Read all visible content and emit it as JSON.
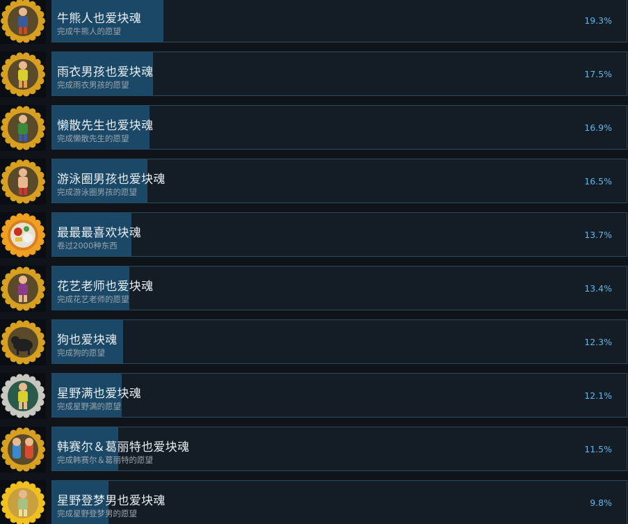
{
  "achievements": [
    {
      "title": "牛熊人也爱块魂",
      "description": "完成牛熊人的愿望",
      "percent_label": "19.3%",
      "percent": 19.3,
      "icon": "character-medallion-icon",
      "palette": [
        "#5a4a2a",
        "#d8a020",
        "#3a5a9a",
        "#c84a20"
      ]
    },
    {
      "title": "雨衣男孩也爱块魂",
      "description": "完成雨衣男孩的愿望",
      "percent_label": "17.5%",
      "percent": 17.5,
      "icon": "character-medallion-icon",
      "palette": [
        "#5a4a2a",
        "#d8a020",
        "#d8d030",
        "#e8a050"
      ]
    },
    {
      "title": "懒散先生也爱块魂",
      "description": "完成懒散先生的愿望",
      "percent_label": "16.9%",
      "percent": 16.9,
      "icon": "character-medallion-icon",
      "palette": [
        "#5a4a2a",
        "#d8a020",
        "#3a8a3a",
        "#3a5ab0"
      ]
    },
    {
      "title": "游泳圈男孩也爱块魂",
      "description": "完成游泳圈男孩的愿望",
      "percent_label": "16.5%",
      "percent": 16.5,
      "icon": "character-medallion-icon",
      "palette": [
        "#5a4a2a",
        "#d8a020",
        "#e8b890",
        "#d83030"
      ]
    },
    {
      "title": "最最最喜欢块魂",
      "description": "卷过2000种东西",
      "percent_label": "13.7%",
      "percent": 13.7,
      "icon": "katamari-ball-medallion-icon",
      "palette": [
        "#d88020",
        "#f0a020",
        "#e8e0d0",
        "#c83020"
      ]
    },
    {
      "title": "花艺老师也爱块魂",
      "description": "完成花艺老师的愿望",
      "percent_label": "13.4%",
      "percent": 13.4,
      "icon": "character-medallion-icon",
      "palette": [
        "#5a4a2a",
        "#d8a020",
        "#8a3a8a",
        "#e8b890"
      ]
    },
    {
      "title": "狗也爱块魂",
      "description": "完成狗的愿望",
      "percent_label": "12.3%",
      "percent": 12.3,
      "icon": "dog-medallion-icon",
      "palette": [
        "#5a4a2a",
        "#d8a020",
        "#202020",
        "#606060"
      ]
    },
    {
      "title": "星野满也爱块魂",
      "description": "完成星野满的愿望",
      "percent_label": "12.1%",
      "percent": 12.1,
      "icon": "character-medallion-icon",
      "palette": [
        "#2a5a4a",
        "#c8c8c0",
        "#d8d030",
        "#e8b890"
      ]
    },
    {
      "title": "韩赛尔＆葛丽特也爱块魂",
      "description": "完成韩赛尔＆葛丽特的愿望",
      "percent_label": "11.5%",
      "percent": 11.5,
      "icon": "twins-medallion-icon",
      "palette": [
        "#5a4a2a",
        "#d8a020",
        "#3a8ad0",
        "#d84a30"
      ]
    },
    {
      "title": "星野登梦男也爱块魂",
      "description": "完成星野登梦男的愿望",
      "percent_label": "9.8%",
      "percent": 9.8,
      "icon": "character-medallion-icon",
      "palette": [
        "#c8a040",
        "#f0c020",
        "#a8c080",
        "#e8e0a0"
      ]
    }
  ]
}
